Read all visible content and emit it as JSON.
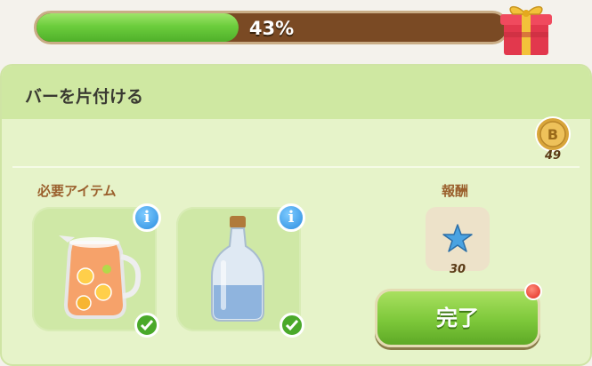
{
  "progress": {
    "value": 0.43,
    "label": "43%"
  },
  "task": {
    "title": "バーを片付ける",
    "coin_count": "49"
  },
  "required": {
    "heading": "必要アイテム",
    "items": [
      {
        "name": "lemonade-pitcher",
        "completed": true
      },
      {
        "name": "water-bottle",
        "completed": true
      }
    ]
  },
  "reward": {
    "heading": "報酬",
    "icon": "blue-star-icon",
    "amount": "30"
  },
  "actions": {
    "complete_label": "完了"
  },
  "colors": {
    "progress_fill": "#6ccd3c",
    "track": "#7a4a24",
    "panel": "#e6f3c9",
    "button": "#7dc83a"
  }
}
